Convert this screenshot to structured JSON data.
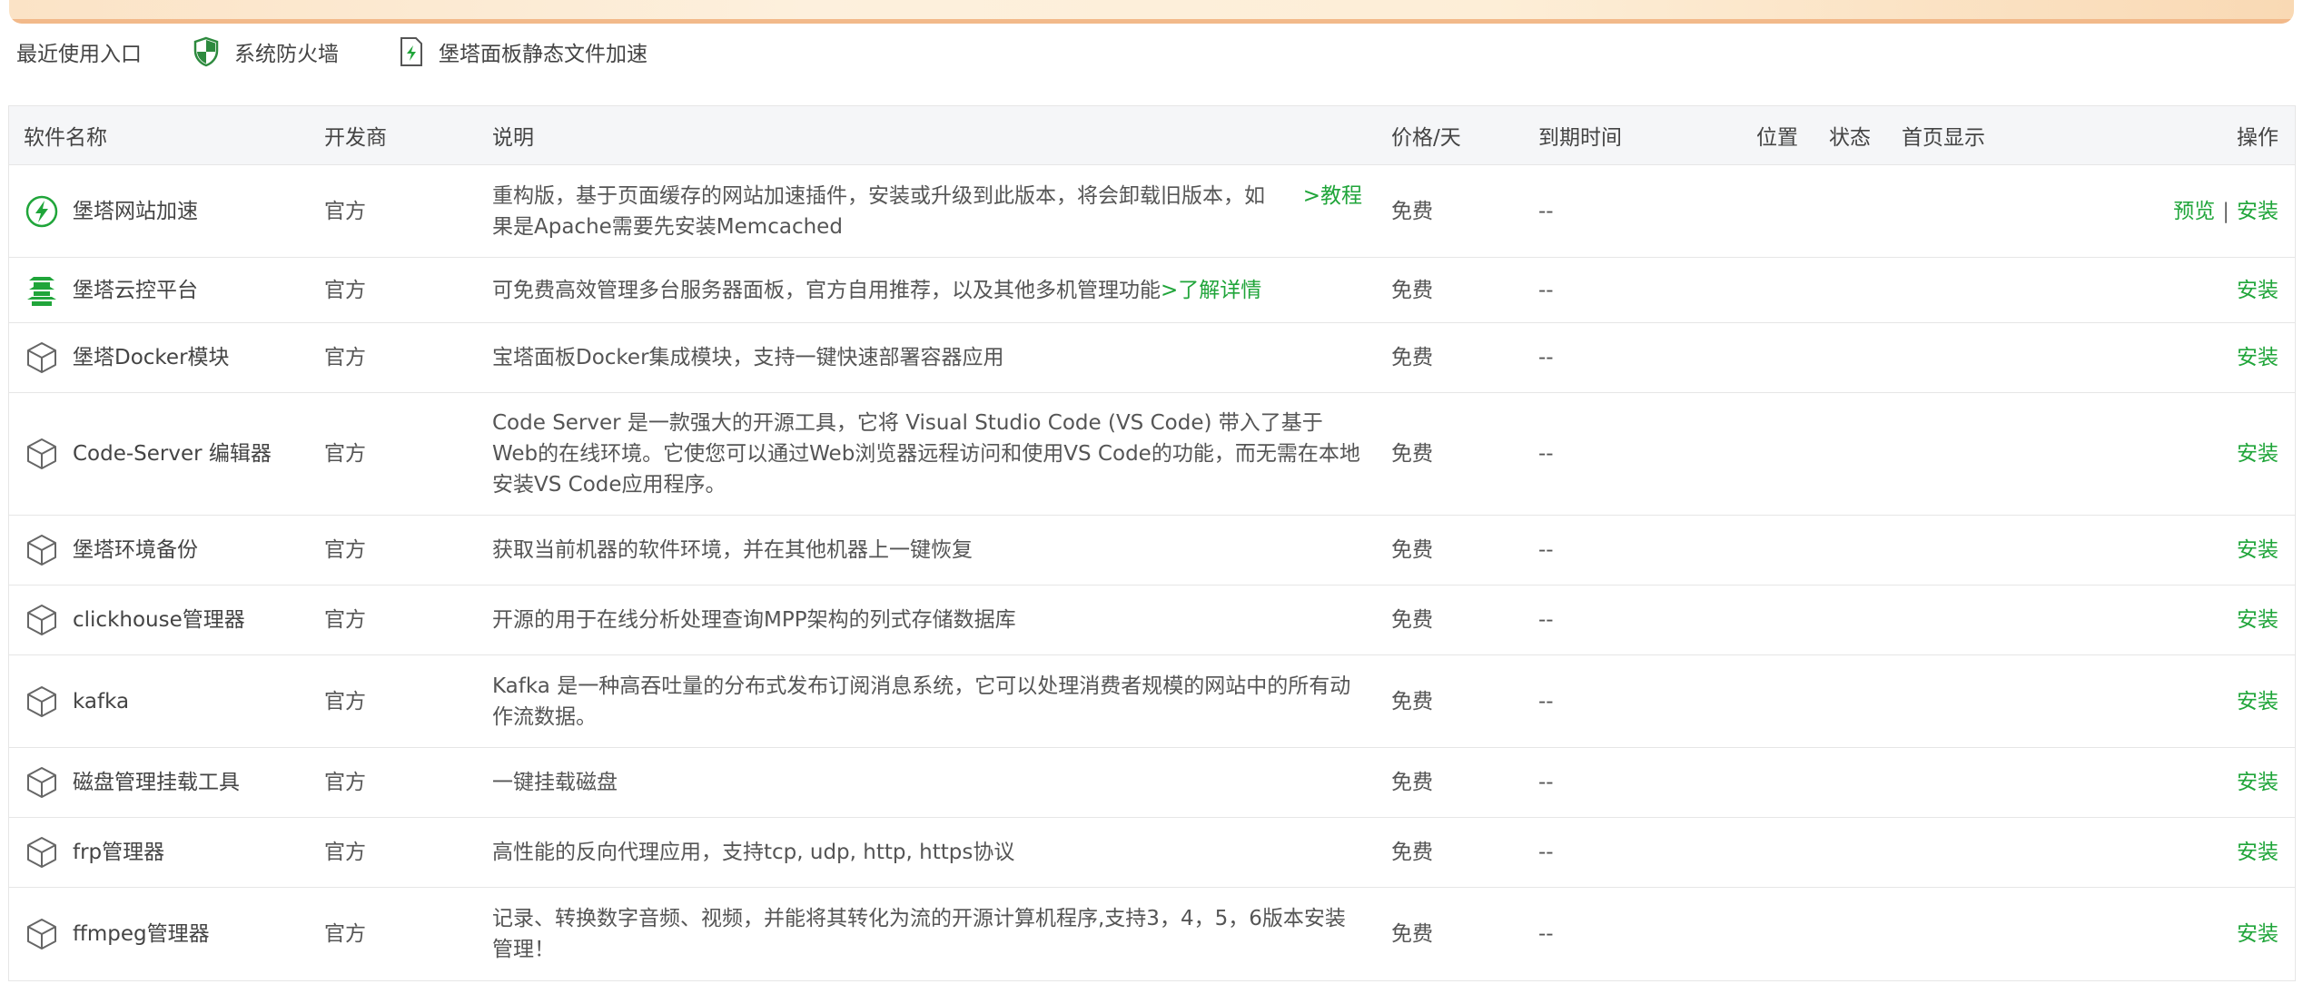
{
  "quickbar": {
    "label": "最近使用入口",
    "items": [
      {
        "label": "系统防火墙",
        "icon": "shield-icon"
      },
      {
        "label": "堡塔面板静态文件加速",
        "icon": "file-bolt-icon"
      }
    ]
  },
  "table": {
    "headers": {
      "name": "软件名称",
      "developer": "开发商",
      "desc": "说明",
      "price": "价格/天",
      "expire": "到期时间",
      "location": "位置",
      "status": "状态",
      "home": "首页显示",
      "ops": "操作"
    },
    "rows": [
      {
        "name": "堡塔网站加速",
        "icon": "bolt-circle-icon",
        "developer": "官方",
        "desc": "重构版，基于页面缓存的网站加速插件，安装或升级到此版本，将会卸载旧版本，如果是Apache需要先安装Memcached",
        "tutorial": ">教程",
        "price": "免费",
        "expire": "--",
        "preview": "预览",
        "sep": "|",
        "install": "安装"
      },
      {
        "name": "堡塔云控平台",
        "icon": "pagoda-icon",
        "developer": "官方",
        "desc": "可免费高效管理多台服务器面板，官方自用推荐，以及其他多机管理功能",
        "desc_link": ">了解详情",
        "price": "免费",
        "expire": "--",
        "install": "安装"
      },
      {
        "name": "堡塔Docker模块",
        "icon": "cube-icon",
        "developer": "官方",
        "desc": "宝塔面板Docker集成模块，支持一键快速部署容器应用",
        "price": "免费",
        "expire": "--",
        "install": "安装"
      },
      {
        "name": "Code-Server 编辑器",
        "icon": "cube-icon",
        "developer": "官方",
        "desc": "Code Server 是一款强大的开源工具，它将 Visual Studio Code (VS Code) 带入了基于Web的在线环境。它使您可以通过Web浏览器远程访问和使用VS Code的功能，而无需在本地安装VS Code应用程序。",
        "price": "免费",
        "expire": "--",
        "install": "安装"
      },
      {
        "name": "堡塔环境备份",
        "icon": "cube-icon",
        "developer": "官方",
        "desc": "获取当前机器的软件环境，并在其他机器上一键恢复",
        "price": "免费",
        "expire": "--",
        "install": "安装"
      },
      {
        "name": "clickhouse管理器",
        "icon": "cube-icon",
        "developer": "官方",
        "desc": "开源的用于在线分析处理查询MPP架构的列式存储数据库",
        "price": "免费",
        "expire": "--",
        "install": "安装"
      },
      {
        "name": "kafka",
        "icon": "cube-icon",
        "developer": "官方",
        "desc": "Kafka 是一种高吞吐量的分布式发布订阅消息系统，它可以处理消费者规模的网站中的所有动作流数据。",
        "price": "免费",
        "expire": "--",
        "install": "安装"
      },
      {
        "name": "磁盘管理挂载工具",
        "icon": "cube-icon",
        "developer": "官方",
        "desc": "一键挂载磁盘",
        "price": "免费",
        "expire": "--",
        "install": "安装"
      },
      {
        "name": "frp管理器",
        "icon": "cube-icon",
        "developer": "官方",
        "desc": "高性能的反向代理应用，支持tcp, udp, http, https协议",
        "price": "免费",
        "expire": "--",
        "install": "安装"
      },
      {
        "name": "ffmpeg管理器",
        "icon": "cube-icon",
        "developer": "官方",
        "desc": "记录、转换数字音频、视频，并能将其转化为流的开源计算机程序,支持3，4，5，6版本安装管理！",
        "price": "免费",
        "expire": "--",
        "install": "安装"
      }
    ]
  },
  "colors": {
    "accent": "#20a53a",
    "header_bg": "#f5f6f8",
    "border": "#e6e6e6"
  }
}
